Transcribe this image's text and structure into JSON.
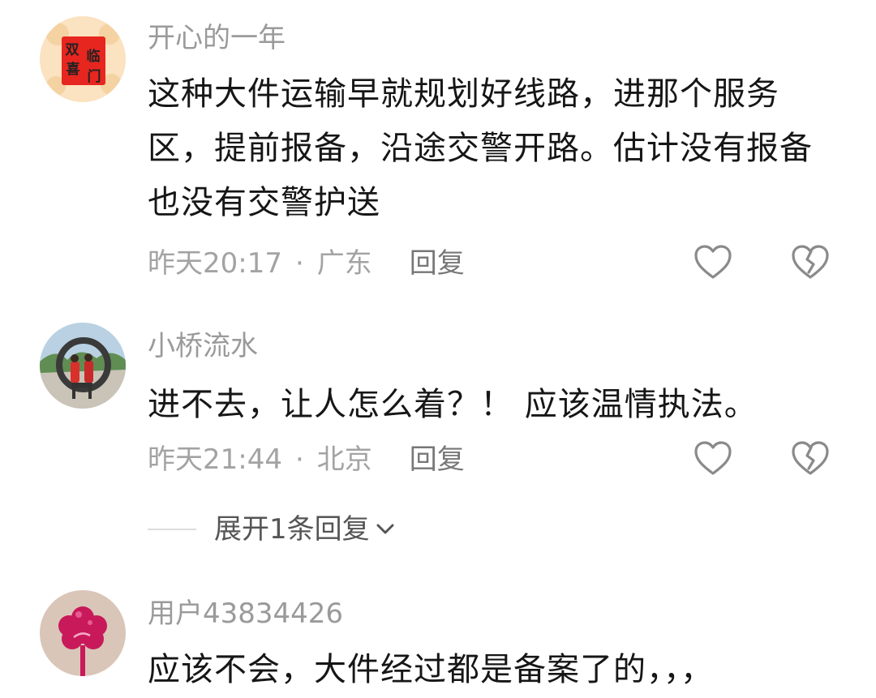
{
  "comments": [
    {
      "username": "开心的一年",
      "avatar_text": [
        "双",
        "喜",
        "临",
        "门"
      ],
      "avatar_icon": "double-happiness-avatar",
      "text": "这种大件运输早就规划好线路，进那个服务区，提前报备，沿途交警开路。估计没有报备也没有交警护送",
      "time": "昨天20:17",
      "separator": "·",
      "location": "广东",
      "reply_label": "回复",
      "like_icon": "heart-outline-icon",
      "dislike_icon": "broken-heart-icon"
    },
    {
      "username": "小桥流水",
      "avatar_icon": "photo-avatar",
      "text": "进不去，让人怎么着？！ 应该温情执法。",
      "time": "昨天21:44",
      "separator": "·",
      "location": "北京",
      "reply_label": "回复",
      "like_icon": "heart-outline-icon",
      "dislike_icon": "broken-heart-icon"
    },
    {
      "username": "用户43834426",
      "avatar_icon": "flower-avatar",
      "text": "应该不会，大件经过都是备案了的，，，"
    }
  ],
  "expand_replies": {
    "label": "展开1条回复",
    "icon": "chevron-down-icon"
  },
  "colors": {
    "username": "#9a9a9a",
    "content": "#161616",
    "meta": "#a3a3a3",
    "reply": "#777777",
    "icon": "#8a8a8a",
    "avatar1_bg": "#fbe2c0",
    "avatar1_card": "#e6261f",
    "avatar3_bg": "#d9c6b8",
    "avatar3_flower": "#c8195a"
  }
}
